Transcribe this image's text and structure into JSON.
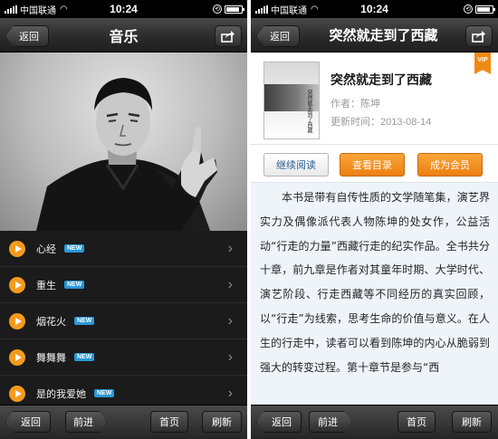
{
  "status_bar": {
    "carrier": "中国联通",
    "time": "10:24",
    "battery_level": 0.85
  },
  "left": {
    "nav": {
      "back_label": "返回",
      "title": "音乐"
    },
    "tracks": [
      {
        "title": "心经",
        "badge": "NEW"
      },
      {
        "title": "重生",
        "badge": "NEW"
      },
      {
        "title": "烟花火",
        "badge": "NEW"
      },
      {
        "title": "舞舞舞",
        "badge": "NEW"
      },
      {
        "title": "是的我爱她",
        "badge": "NEW"
      }
    ],
    "toolbar": {
      "back_label": "返回",
      "forward_label": "前进",
      "home_label": "首页",
      "refresh_label": "刷新"
    }
  },
  "right": {
    "nav": {
      "back_label": "返回",
      "title": "突然就走到了西藏"
    },
    "book": {
      "title": "突然就走到了西藏",
      "author_label": "作者：",
      "author": "陈坤",
      "updated_label": "更新时间：",
      "updated": "2013-08-14",
      "vip_badge": "VIP",
      "cover_text": "突然就走到了西藏"
    },
    "actions": {
      "continue_label": "继续阅读",
      "catalog_label": "查看目录",
      "member_label": "成为会员"
    },
    "description": "本书是带有自传性质的文学随笔集，演艺界实力及偶像派代表人物陈坤的处女作，公益活动“行走的力量”西藏行走的纪实作品。全书共分十章，前九章是作者对其童年时期、大学时代、演艺阶段、行走西藏等不同经历的真实回顾，以“行走”为线索，思考生命的价值与意义。在人生的行走中，读者可以看到陈坤的内心从脆弱到强大的转变过程。第十章节是参与“西",
    "toolbar": {
      "back_label": "返回",
      "forward_label": "前进",
      "home_label": "首页",
      "refresh_label": "刷新"
    }
  },
  "colors": {
    "accent_orange": "#f39a1e",
    "badge_blue": "#2a97d6",
    "link_blue": "#2d5f95"
  },
  "icons": {
    "share": "share-icon",
    "play": "play-icon",
    "chevron": "chevron-right-icon"
  }
}
